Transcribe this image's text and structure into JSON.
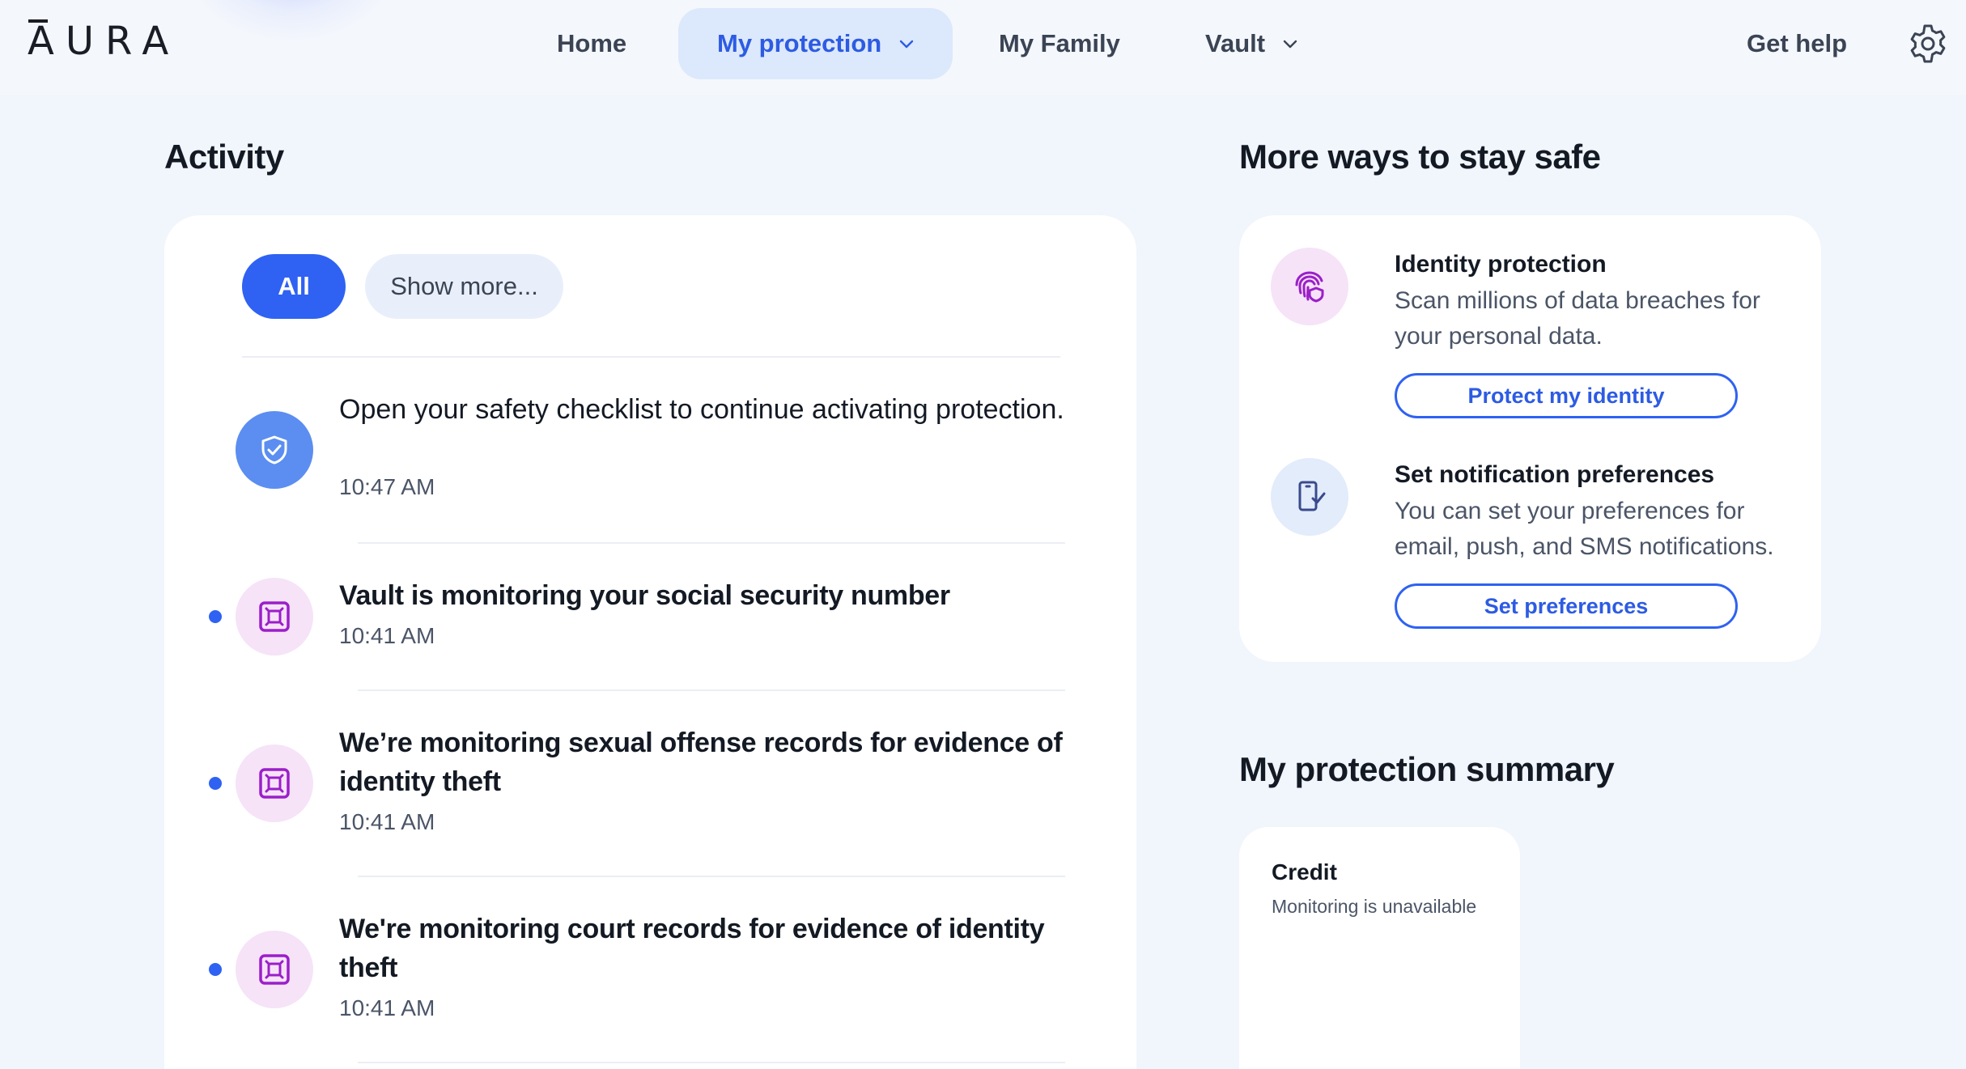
{
  "nav": {
    "logo": "AURA",
    "items": [
      {
        "label": "Home"
      },
      {
        "label": "My protection"
      },
      {
        "label": "My Family"
      },
      {
        "label": "Vault"
      }
    ],
    "help": "Get help"
  },
  "activity": {
    "heading": "Activity",
    "filters": {
      "all": "All",
      "more": "Show more..."
    },
    "items": [
      {
        "title": "Open your safety checklist to continue activating protection.",
        "time": "10:47 AM",
        "icon": "shield-check-icon",
        "unread": false
      },
      {
        "title": "Vault is monitoring your social security number",
        "time": "10:41 AM",
        "icon": "vault-icon",
        "unread": true
      },
      {
        "title": "We’re monitoring sexual offense records for evidence of identity theft",
        "time": "10:41 AM",
        "icon": "vault-icon",
        "unread": true
      },
      {
        "title": "We're monitoring court records for evidence of identity theft",
        "time": "10:41 AM",
        "icon": "vault-icon",
        "unread": true
      }
    ]
  },
  "safe": {
    "heading": "More ways to stay safe",
    "items": [
      {
        "title": "Identity protection",
        "desc": "Scan millions of data breaches for your personal data.",
        "button": "Protect my identity",
        "icon": "fingerprint-shield-icon"
      },
      {
        "title": "Set notification preferences",
        "desc": "You can set your preferences for email, push, and SMS notifications.",
        "button": "Set preferences",
        "icon": "phone-check-icon"
      }
    ]
  },
  "summary": {
    "heading": "My protection summary",
    "credit": {
      "title": "Credit",
      "status": "Monitoring is unavailable"
    }
  },
  "colors": {
    "accent": "#2f62f2",
    "background": "#f1f5fc",
    "vault_pink": "#f6e3f8",
    "vault_purple": "#9b1fc9"
  }
}
